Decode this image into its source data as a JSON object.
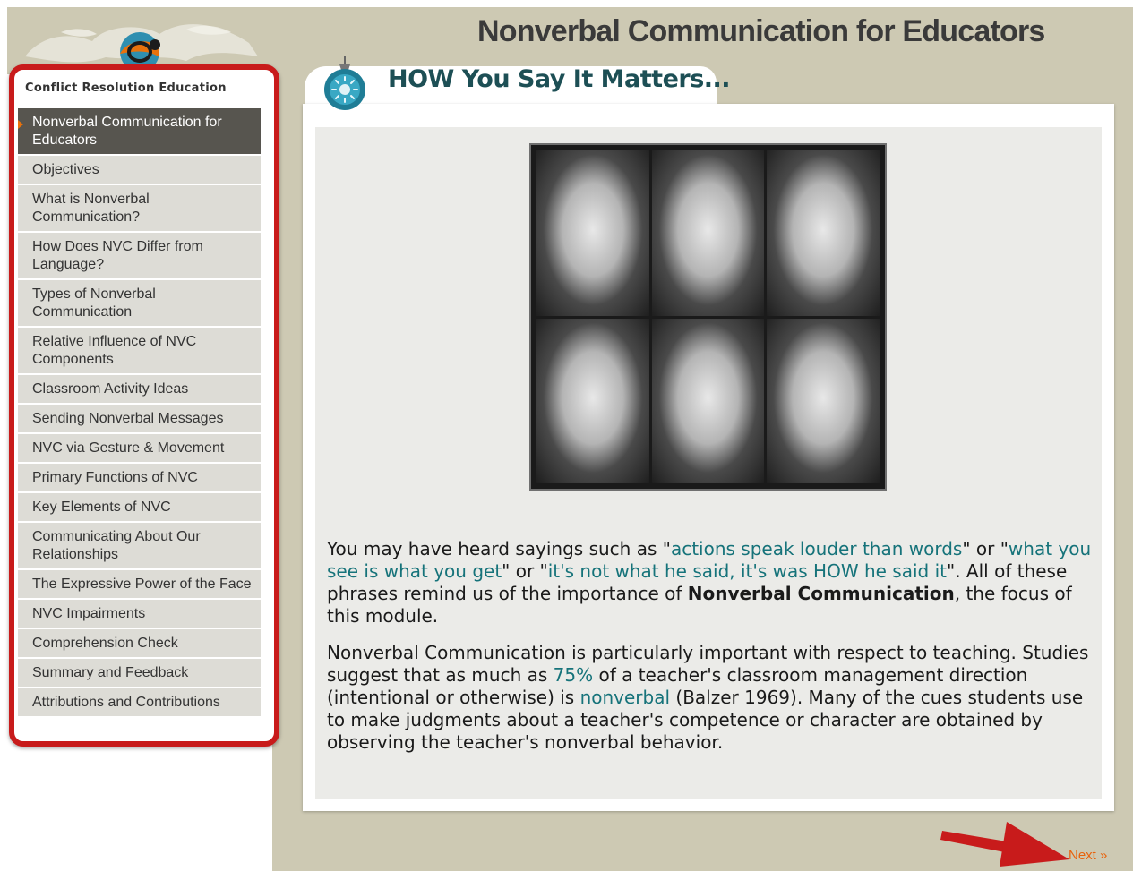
{
  "page": {
    "title": "Nonverbal Communication for Educators"
  },
  "sidebar": {
    "heading": "Conflict Resolution Education",
    "items": [
      {
        "label": "Nonverbal Communication for Educators"
      },
      {
        "label": "Objectives"
      },
      {
        "label": "What is Nonverbal Communication?"
      },
      {
        "label": "How Does NVC Differ from Language?"
      },
      {
        "label": "Types of Nonverbal Communication"
      },
      {
        "label": "Relative Influence of NVC Components"
      },
      {
        "label": "Classroom Activity Ideas"
      },
      {
        "label": "Sending Nonverbal Messages"
      },
      {
        "label": "NVC via Gesture & Movement"
      },
      {
        "label": "Primary Functions of NVC"
      },
      {
        "label": "Key Elements of NVC"
      },
      {
        "label": "Communicating About Our Relationships"
      },
      {
        "label": "The Expressive Power of the Face"
      },
      {
        "label": "NVC Impairments"
      },
      {
        "label": "Comprehension Check"
      },
      {
        "label": "Summary and Feedback"
      },
      {
        "label": "Attributions and Contributions"
      }
    ],
    "active_index": 0
  },
  "section": {
    "heading": "HOW You Say It Matters..."
  },
  "content": {
    "p1": {
      "t1": "You may have heard sayings such as \"",
      "q1": "actions speak louder than words",
      "t2": "\" or \"",
      "q2": "what you see is what you get",
      "t3": "\" or \"",
      "q3": "it's not what he said, it's was HOW he said it",
      "t4": "\". All of these phrases remind us of the importance of ",
      "b1": "Nonverbal Communication",
      "t5": ", the focus of this module."
    },
    "p2": {
      "t1": "Nonverbal Communication is particularly important with respect to teaching. Studies suggest that as much as ",
      "hl1": "75%",
      "t2": " of a teacher's classroom management direction (intentional or otherwise) is ",
      "hl2": "nonverbal",
      "t3": " (Balzer 1969). Many of the cues students use to make judgments about a teacher's competence or character are obtained by observing the teacher's nonverbal behavior."
    }
  },
  "footer": {
    "next_label": "Next »"
  },
  "colors": {
    "accent_red": "#c81b1b",
    "link_teal": "#16737a",
    "next_orange": "#e8620c",
    "heading_teal": "#1d4f55"
  },
  "icons": [
    "globe-logo-icon",
    "section-ornament-icon",
    "red-arrow-icon"
  ]
}
